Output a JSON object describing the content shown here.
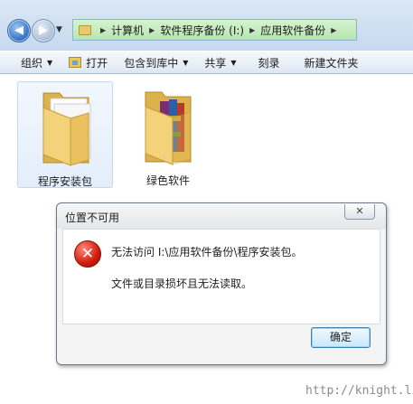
{
  "address": {
    "crumbs": [
      "计算机",
      "软件程序备份 (I:)",
      "应用软件备份"
    ]
  },
  "toolbar": {
    "organize": "组织",
    "open": "打开",
    "include_in_library": "包含到库中",
    "share": "共享",
    "burn": "刻录",
    "new_folder": "新建文件夹"
  },
  "files": [
    {
      "name": "程序安装包",
      "selected": true,
      "icon": "folder-documents-icon"
    },
    {
      "name": "绿色软件",
      "selected": false,
      "icon": "folder-books-icon"
    }
  ],
  "dialog": {
    "title": "位置不可用",
    "close": "✕",
    "message_line1": "无法访问 I:\\应用软件备份\\程序安装包。",
    "message_line2": "文件或目录损坏且无法读取。",
    "ok_label": "确定"
  },
  "watermark": "http://knight.li",
  "colors": {
    "address_green": "#b7e6b0",
    "toolbar_blue": "#dde7f3",
    "error_red": "#d21b0b",
    "ok_button": "#c9e7fb"
  }
}
